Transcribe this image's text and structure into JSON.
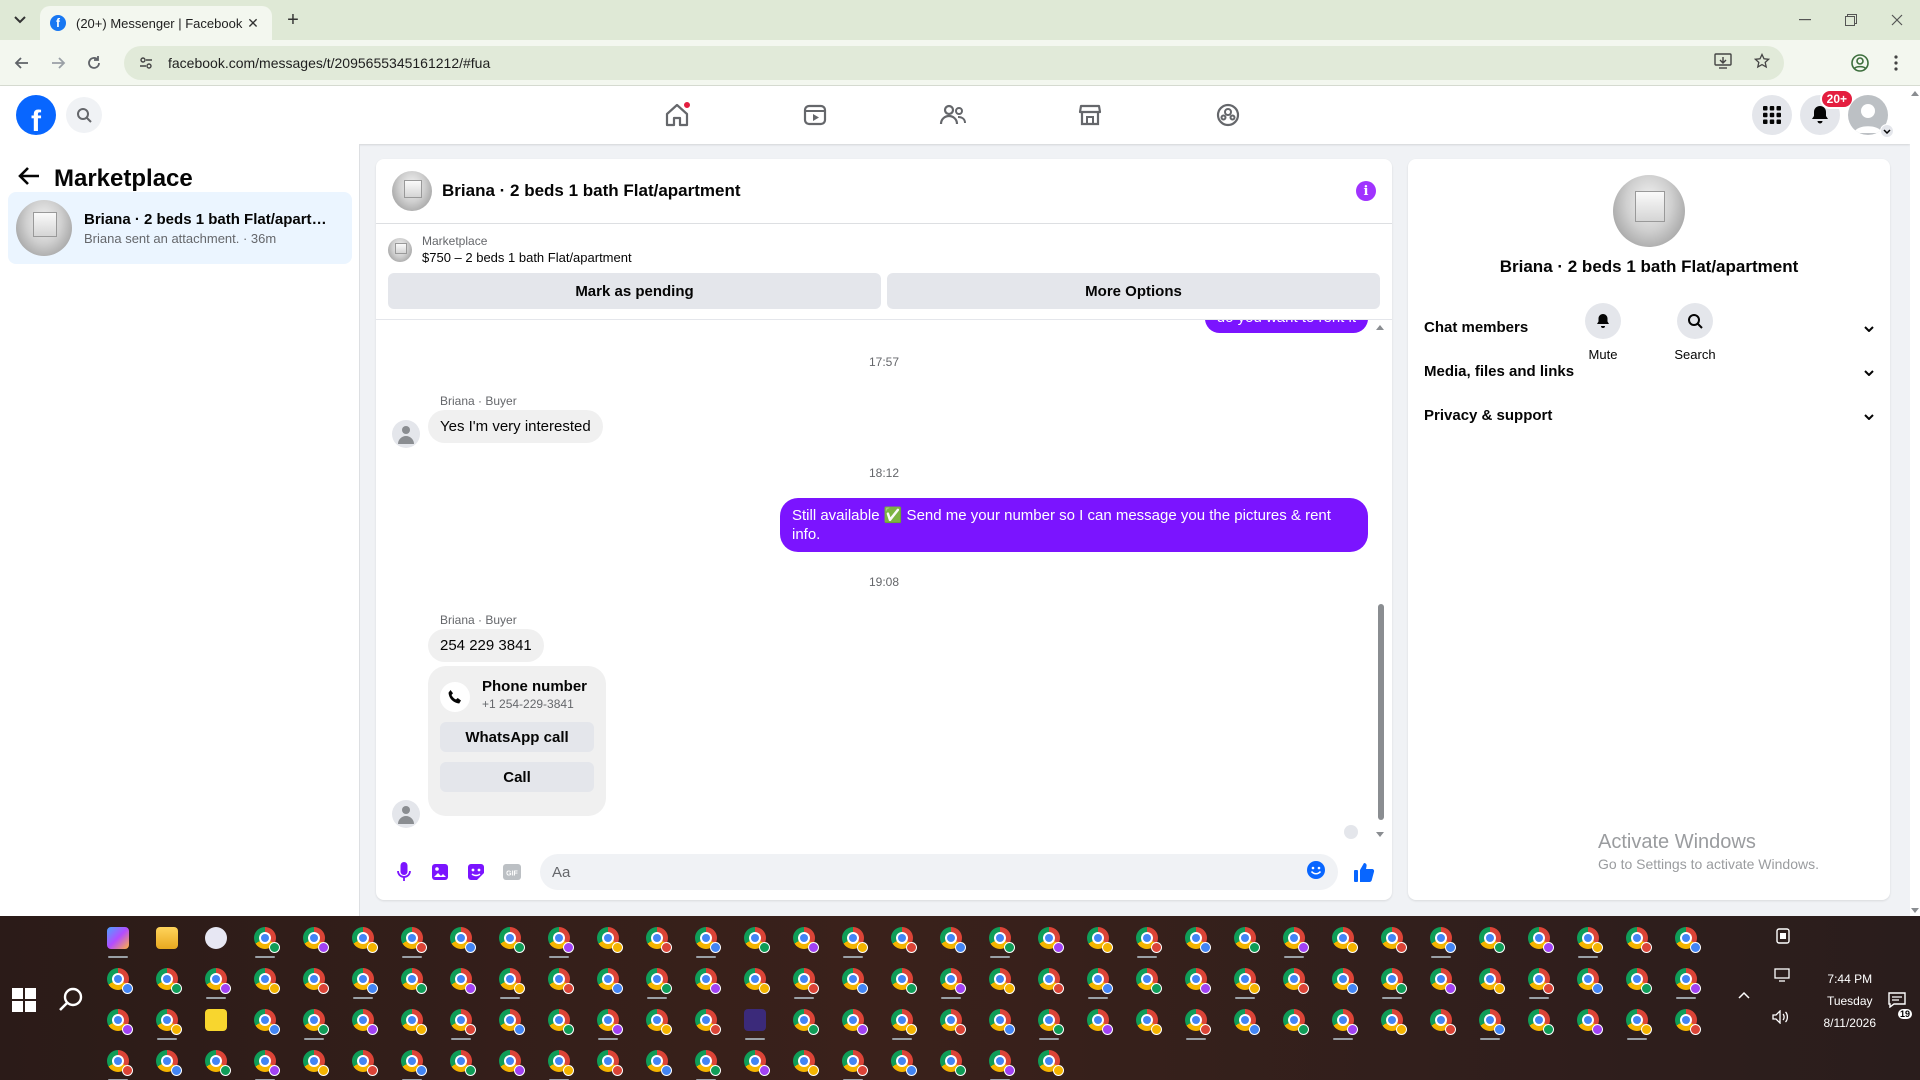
{
  "browser": {
    "tab_title": "(20+) Messenger | Facebook",
    "url": "facebook.com/messages/t/2095655345161212/#fua",
    "new_tab": "+",
    "close_tab": "✕"
  },
  "fb": {
    "logo": "f",
    "notifications_badge": "20+",
    "nav_icons": [
      "home-icon",
      "video-icon",
      "friends-icon",
      "marketplace-icon",
      "gaming-icon"
    ]
  },
  "sidebar": {
    "title": "Marketplace",
    "conversation": {
      "name": "Briana · 2 beds 1 bath Flat/apartm...",
      "subtitle": "Briana sent an attachment. · 36m"
    }
  },
  "chat": {
    "title": "Briana · 2 beds 1 bath Flat/apartment",
    "marketplace_label": "Marketplace",
    "listing": "$750 – 2 beds 1 bath Flat/apartment",
    "mark_pending": "Mark as pending",
    "more_options": "More Options",
    "partial_top": "do you want to rent it",
    "messages": [
      {
        "time": "17:57"
      },
      {
        "sender": "Briana · Buyer",
        "text": "Yes I'm very interested"
      },
      {
        "time": "18:12"
      },
      {
        "text_out": "Still available ✅ Send me your number so I can message you the pictures & rent info."
      },
      {
        "time": "19:08"
      },
      {
        "sender": "Briana · Buyer",
        "text": "254 229 3841"
      }
    ],
    "phone_card": {
      "title": "Phone number",
      "number": "+1 254-229-3841",
      "whatsapp": "WhatsApp call",
      "call": "Call"
    },
    "composer_placeholder": "Aa"
  },
  "details": {
    "name": "Briana · 2 beds 1 bath Flat/apartment",
    "mute": "Mute",
    "search": "Search",
    "sections": [
      "Chat members",
      "Media, files and links",
      "Privacy & support"
    ],
    "activate_title": "Activate Windows",
    "activate_sub": "Go to Settings to activate Windows."
  },
  "taskbar": {
    "time": "7:44 PM",
    "day": "Tuesday",
    "date": "8/11/2026",
    "notif_count": "19"
  },
  "colors": {
    "accent": "#7b14ff",
    "fb_blue": "#0866ff",
    "badge": "#e41e3f"
  }
}
